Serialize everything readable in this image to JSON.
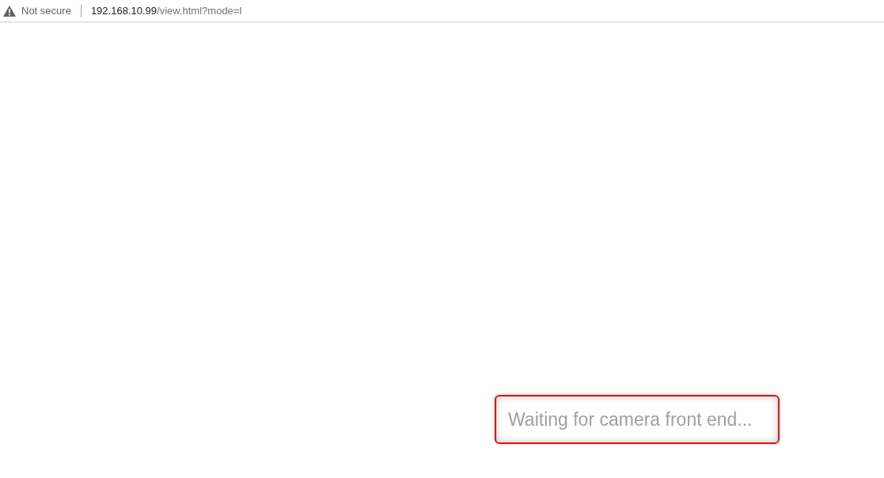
{
  "address_bar": {
    "security_label": "Not secure",
    "url_host": "192.168.10.99",
    "url_path": "/view.html?mode=l"
  },
  "status_message": {
    "text": "Waiting for camera front end..."
  }
}
